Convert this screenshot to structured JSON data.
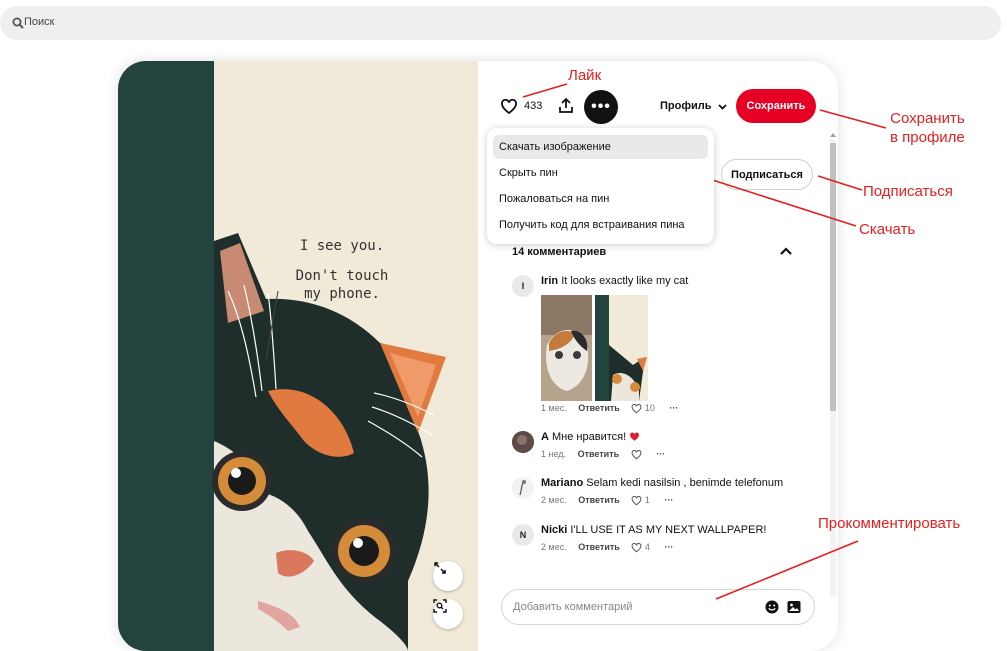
{
  "search": {
    "placeholder": "Поиск"
  },
  "pin": {
    "image_text_line1": "I see you.",
    "image_text_line2": "Don't touch",
    "image_text_line3": "my phone."
  },
  "toolbar": {
    "like_count": "433",
    "more_label": "•••",
    "profile_label": "Профиль",
    "save_label": "Сохранить"
  },
  "menu": {
    "items": [
      {
        "label": "Скачать изображение"
      },
      {
        "label": "Скрыть пин"
      },
      {
        "label": "Пожаловаться на пин"
      },
      {
        "label": "Получить код для встраивания пина"
      }
    ]
  },
  "follow_label": "Подписаться",
  "comments": {
    "header": "14 комментариев",
    "reply_label": "Ответить",
    "items": [
      {
        "avatar": "I",
        "author": "Irin",
        "text": "It looks exactly like my cat",
        "time": "1 мес.",
        "likes": "10"
      },
      {
        "avatar": "",
        "author": "A",
        "text": "Мне нравится!",
        "time": "1 нед.",
        "likes": ""
      },
      {
        "avatar": "",
        "author": "Mariano",
        "text": "Selam kedi nasilsin , benimde telefonum",
        "time": "2 мес.",
        "likes": "1"
      },
      {
        "avatar": "N",
        "author": "Nicki",
        "text": "I'LL USE IT AS MY NEXT WALLPAPER!",
        "time": "2 мес.",
        "likes": "4"
      }
    ],
    "more_label": "···"
  },
  "comment_input": {
    "placeholder": "Добавить комментарий"
  },
  "annotations": {
    "like": "Лайк",
    "save_line1": "Сохранить",
    "save_line2": "в профиле",
    "follow": "Подписаться",
    "download": "Скачать",
    "comment": "Прокомментировать"
  },
  "colors": {
    "save_red": "#e60023",
    "annotation_red": "#e32020",
    "pin_teal": "#23433f",
    "pin_cream": "#f1ead8",
    "cat_orange": "#e07a3f"
  }
}
